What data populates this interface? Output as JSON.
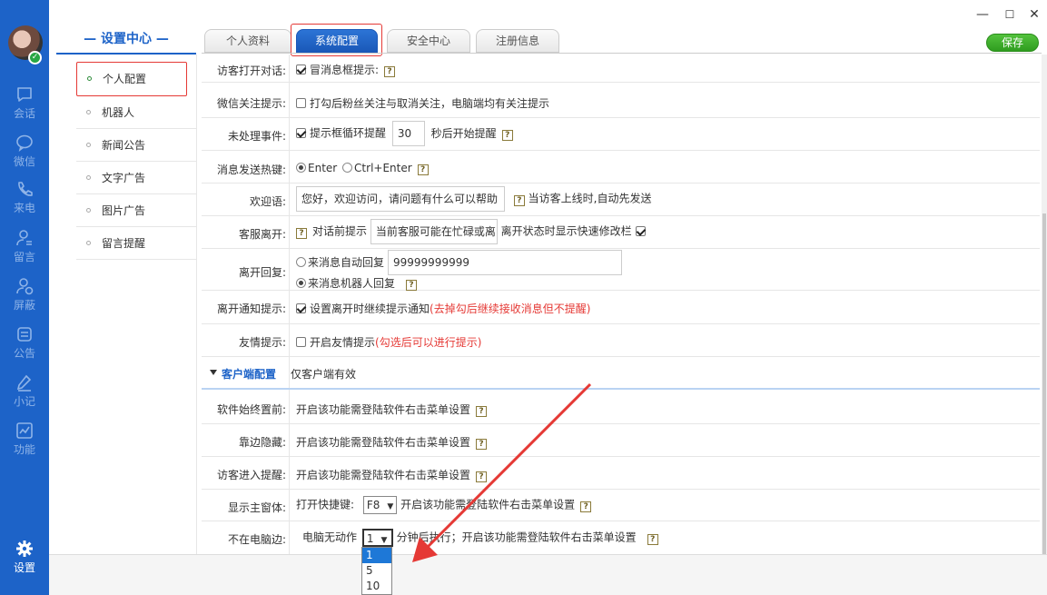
{
  "window_controls": {
    "minimize": "—",
    "maximize": "☐",
    "close": "✕"
  },
  "rail": {
    "items": [
      {
        "label": "会话",
        "icon": "chat-bubble-icon"
      },
      {
        "label": "微信",
        "icon": "wechat-icon"
      },
      {
        "label": "来电",
        "icon": "phone-icon"
      },
      {
        "label": "留言",
        "icon": "message-user-icon"
      },
      {
        "label": "屏蔽",
        "icon": "block-user-icon"
      },
      {
        "label": "公告",
        "icon": "notice-icon"
      },
      {
        "label": "小记",
        "icon": "pen-icon"
      },
      {
        "label": "功能",
        "icon": "chart-icon"
      },
      {
        "label": "设置",
        "icon": "gear-icon"
      }
    ],
    "avatar_status": "✓"
  },
  "nav": {
    "title": "— 设置中心 —",
    "items": [
      {
        "label": "个人配置"
      },
      {
        "label": "机器人"
      },
      {
        "label": "新闻公告"
      },
      {
        "label": "文字广告"
      },
      {
        "label": "图片广告"
      },
      {
        "label": "留言提醒"
      }
    ]
  },
  "tabs": [
    {
      "label": "个人资料"
    },
    {
      "label": "系统配置"
    },
    {
      "label": "安全中心"
    },
    {
      "label": "注册信息"
    }
  ],
  "save_label": "保存",
  "rows": {
    "visitor_open": {
      "label": "访客打开对话:",
      "text": "冒消息框提示:"
    },
    "wechat_follow": {
      "label": "微信关注提示:",
      "text": "打勾后粉丝关注与取消关注，电脑端均有关注提示"
    },
    "unhandled": {
      "label": "未处理事件:",
      "text1": "提示框循环提醒",
      "seconds": "30",
      "text2": "秒后开始提醒"
    },
    "hotkey": {
      "label": "消息发送热键:",
      "opt1": "Enter",
      "opt2": "Ctrl+Enter"
    },
    "welcome": {
      "label": "欢迎语:",
      "value": "您好，欢迎访问，请问题有什么可以帮助",
      "hint": "当访客上线时,自动先发送"
    },
    "agent_leave": {
      "label": "客服离开:",
      "text1": "对话前提示",
      "value": "当前客服可能在忙碌或离",
      "text2": "离开状态时显示快速修改栏"
    },
    "leave_reply": {
      "label": "离开回复:",
      "opt1": "来消息自动回复",
      "value": "99999999999",
      "opt2": "来消息机器人回复"
    },
    "leave_notify": {
      "label": "离开通知提示:",
      "text": "设置离开时继续提示通知",
      "red": "(去掉勾后继续接收消息但不提醒)"
    },
    "friendly": {
      "label": "友情提示:",
      "text": "开启友情提示",
      "red": "(勾选后可以进行提示)"
    }
  },
  "section": {
    "title": "客户端配置",
    "subtitle": "仅客户端有效"
  },
  "client_rows": {
    "always_top": {
      "label": "软件始终置前:",
      "text": "开启该功能需登陆软件右击菜单设置"
    },
    "edge_hide": {
      "label": "靠边隐藏:",
      "text": "开启该功能需登陆软件右击菜单设置"
    },
    "visitor_enter": {
      "label": "访客进入提醒:",
      "text": "开启该功能需登陆软件右击菜单设置"
    },
    "main_window": {
      "label": "显示主窗体:",
      "text1": "打开快捷键:",
      "key": "F8",
      "text2": "开启该功能需登陆软件右击菜单设置"
    },
    "away": {
      "label": "不在电脑边:",
      "text1": "电脑无动作",
      "minutes": "1",
      "text2": "分钟后执行；开启该功能需登陆软件右击菜单设置"
    }
  },
  "dropdown_options": [
    "1",
    "5",
    "10"
  ],
  "help_glyph": "?",
  "caret_glyph": "▼",
  "accent_color": "#1d63c8",
  "save_color": "#3aaa2a",
  "annotation_color": "#e53935"
}
